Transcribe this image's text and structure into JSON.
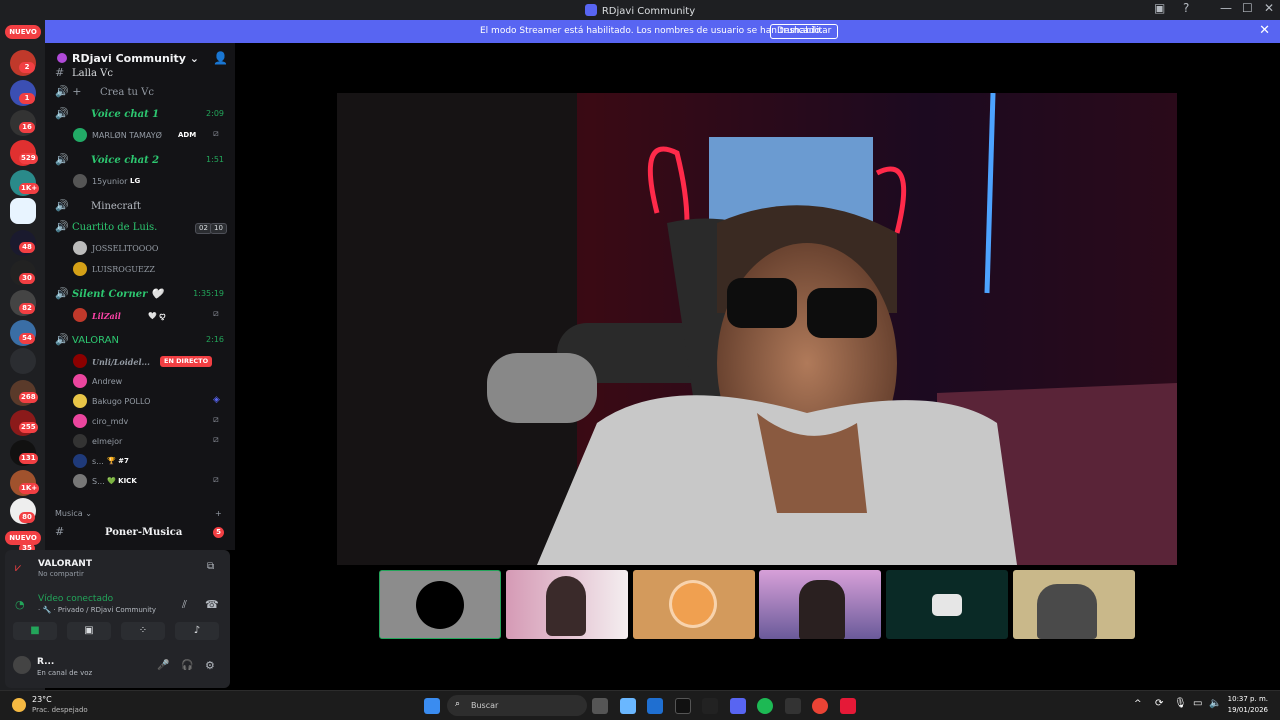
{
  "window": {
    "title": "RDjavi Community",
    "minimize": "—",
    "maximize": "☐",
    "close": "✕"
  },
  "banner": {
    "message": "El modo Streamer está habilitado. Los nombres de usuario se han truncado.",
    "button": "Deshabilitar",
    "close": "✕"
  },
  "rail": {
    "nuevo_top": "NUEVO",
    "nuevo_bottom": "NUEVO",
    "badges": [
      "2",
      "1",
      "16",
      "529",
      "1K+",
      "48",
      "30",
      "82",
      "54",
      "268",
      "255",
      "131",
      "1K+",
      "80",
      "35"
    ]
  },
  "sidebar": {
    "server_name": "RDjavi Community ⌄",
    "channels": {
      "lalla": "Lalla Vc",
      "crea": "Crea tu Vc",
      "voice1": {
        "name": "Voice chat 1",
        "time": "2:09"
      },
      "voice1_user": {
        "name": "MARLØN TAMAYØ",
        "tag": "ADM"
      },
      "voice2": {
        "name": "Voice chat 2",
        "time": "1:51"
      },
      "voice2_user": {
        "name": "15yunior",
        "tag": "LG"
      },
      "minecraft": "Minecraft",
      "cuartito": {
        "name": "Cuartito de Luis.",
        "count_a": "02",
        "count_b": "10"
      },
      "cuartito_user1": "JOSSELITOOOO",
      "cuartito_user2": "LUISROGUEZZ",
      "silent": {
        "name": "Silent Corner 🤍",
        "time": "1:35:19"
      },
      "silent_user": {
        "name": "LilZail",
        "tag": "🤍 ꨄ"
      },
      "valoran": {
        "name": "VALORAN",
        "time": "2:16"
      },
      "valoran_users": [
        "Unli/Loidel...",
        "Andrew",
        "Bakugo POLLO",
        "ciro_mdv",
        "elmejor",
        "s...",
        "S..."
      ],
      "valoran_live": "EN DIRECTO",
      "valoran_tag_s": "🏆 #7",
      "valoran_tag_s2": "💚 KICK",
      "musica_cat": "Musica ⌄",
      "poner_musica": "Poner-Musica",
      "poner_badge": "5"
    }
  },
  "panel": {
    "activity": "VALORANT",
    "activity_sub": "No compartir",
    "voice_status": "Vídeo conectado",
    "voice_sub": "· 🔧 · Privado / RDjavi Community",
    "user": "R...",
    "user_status": "En canal de voz"
  },
  "taskbar": {
    "weather_temp": "23°C",
    "weather_desc": "Prac. despejado",
    "search": "Buscar",
    "time": "10:37 p. m.",
    "date": "19/01/2026"
  },
  "colors": {
    "accent": "#5865f2",
    "voice_green": "#23a55a",
    "danger": "#f23f43"
  }
}
